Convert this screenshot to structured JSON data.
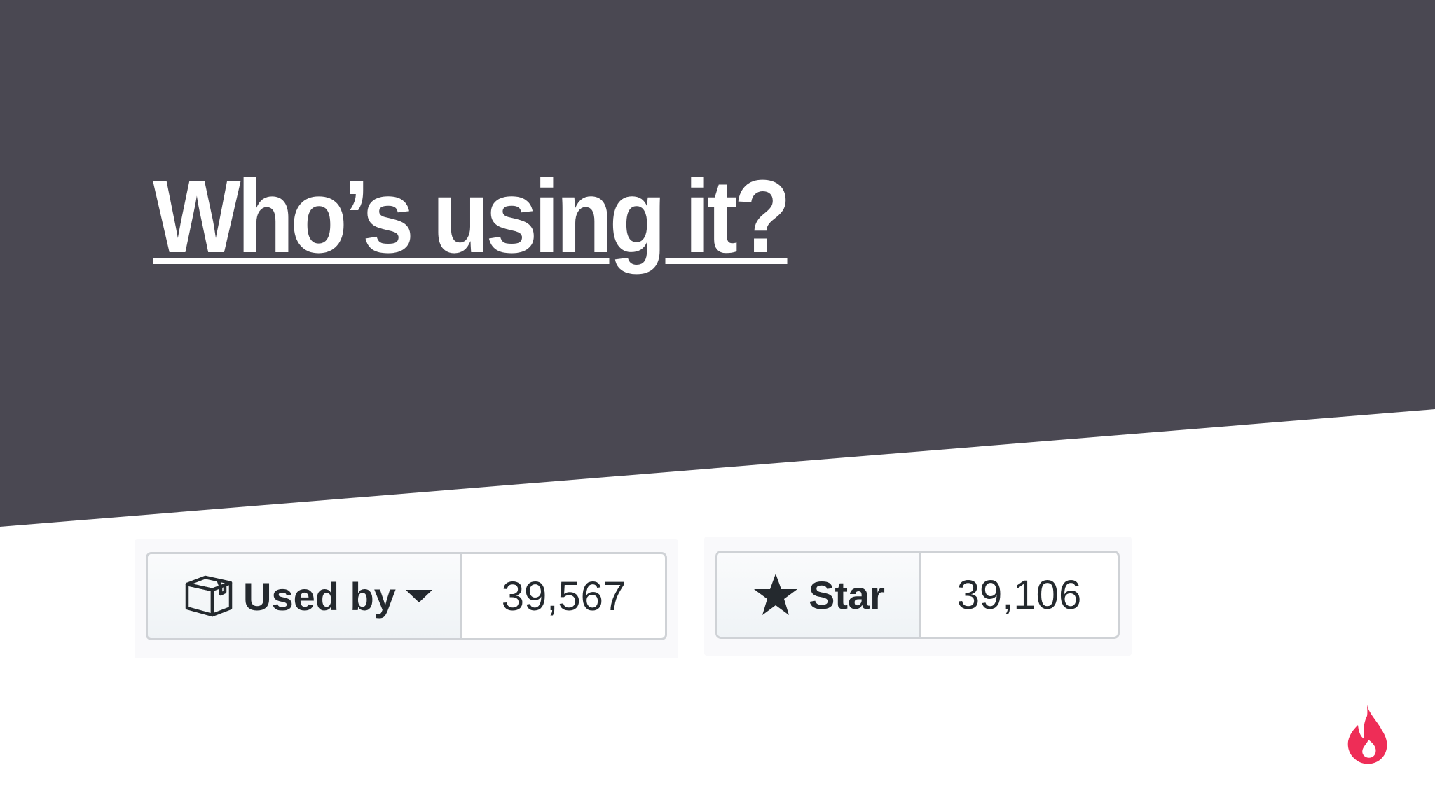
{
  "slide": {
    "title": "Who’s using it?"
  },
  "used_by_widget": {
    "label": "Used by",
    "count": "39,567",
    "icon": "package-icon",
    "dropdown_icon": "caret-down-icon"
  },
  "star_widget": {
    "label": "Star",
    "count": "39,106",
    "icon": "star-icon"
  },
  "colors": {
    "band": "#4a4852",
    "title": "#ffffff",
    "logo": "#ee2d57",
    "button_text": "#24292e",
    "border": "#cfd2d6"
  },
  "logo": {
    "icon": "flame-logo-icon"
  }
}
